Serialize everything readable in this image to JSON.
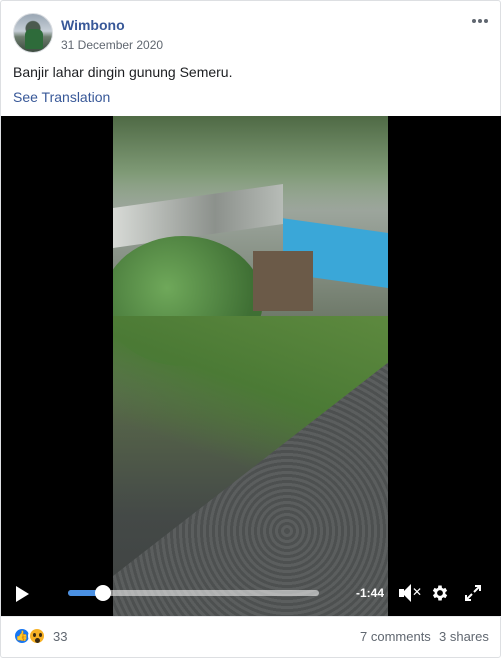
{
  "post": {
    "author": "Wimbono",
    "date": "31 December 2020",
    "caption": "Banjir lahar dingin gunung Semeru.",
    "see_translation": "See Translation",
    "more_icon": "more-horizontal-icon"
  },
  "video": {
    "time_remaining": "-1:44",
    "progress": 0.14,
    "icons": [
      "play-icon",
      "volume-muted-icon",
      "gear-icon",
      "fullscreen-icon"
    ],
    "accent_color": "#4a90e2"
  },
  "footer": {
    "reactions": [
      "like-reaction-icon",
      "wow-reaction-icon"
    ],
    "reaction_count": "33",
    "comments": "7 comments",
    "shares": "3 shares"
  }
}
